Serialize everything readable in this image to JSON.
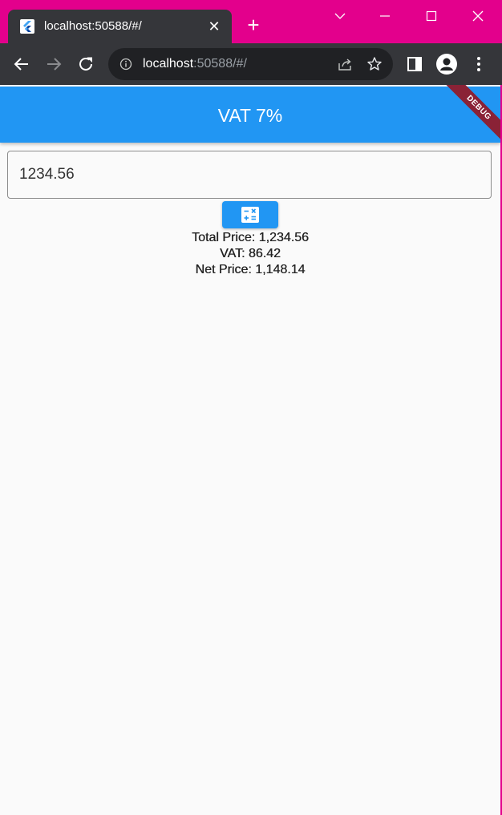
{
  "browser": {
    "tab_title": "localhost:50588/#/",
    "url_host": "localhost",
    "url_path": ":50588/#/",
    "frame_color": "#e3008c",
    "toolbar_color": "#35363a"
  },
  "app": {
    "title": "VAT 7%",
    "debug_label": "DEBUG",
    "accent": "#2196f3",
    "input_value": "1234.56",
    "calculate_icon": "calculate-icon",
    "results": {
      "total_price": "Total Price: 1,234.56",
      "vat": "VAT: 86.42",
      "net_price": "Net Price: 1,148.14"
    }
  }
}
